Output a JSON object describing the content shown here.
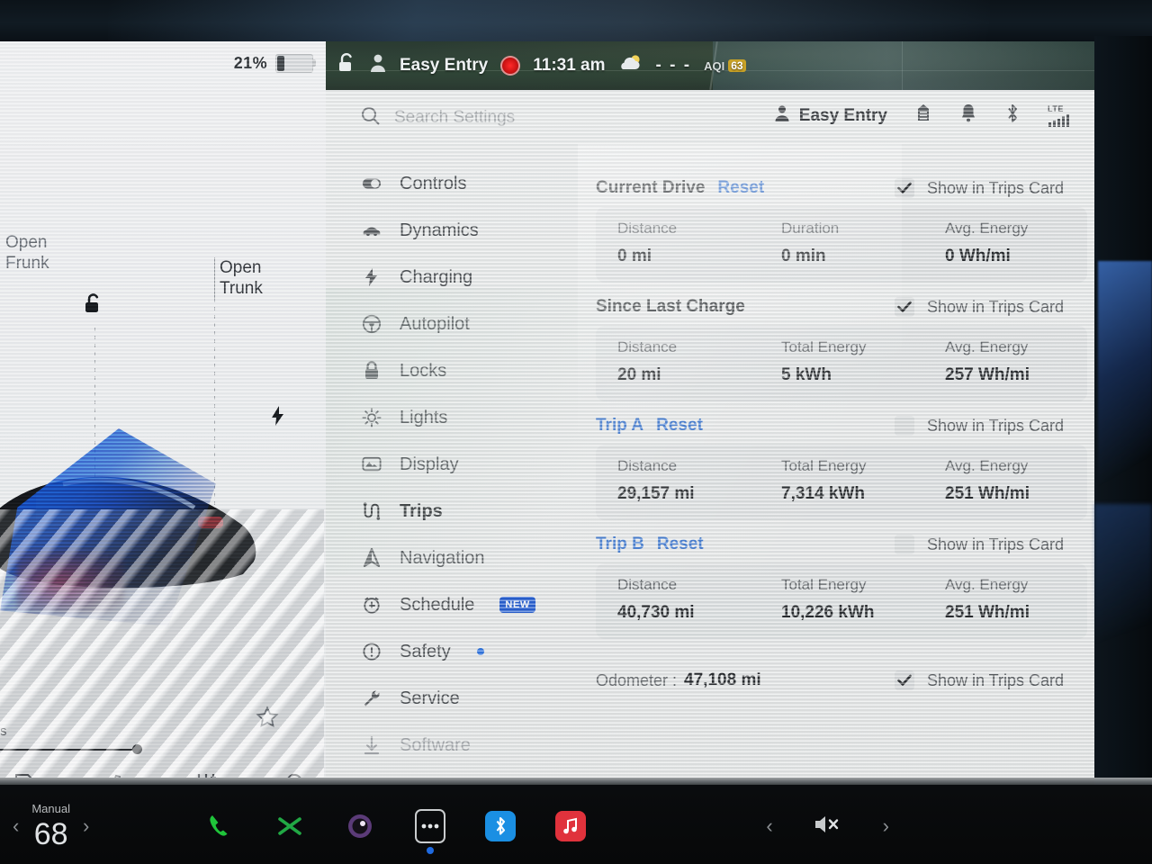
{
  "status_bar": {
    "lock_icon": "unlock-icon",
    "profile_icon": "person-icon",
    "profile_name": "Easy Entry",
    "record_icon": "record-dot-icon",
    "time": "11:31 am",
    "weather_icon": "partly-cloudy-icon",
    "temperature": "- - -",
    "aqi_label": "AQI",
    "aqi_value": "63"
  },
  "left_panel": {
    "battery_percent": "21%",
    "battery_level": 21,
    "frunk_label": "Open\nFrunk",
    "frunk_label_line1": "Open",
    "frunk_label_line2": "Frunk",
    "trunk_label_line1": "Open",
    "trunk_label_line2": "Trunk",
    "unlock_icon": "unlock-icon",
    "charge_icon": "bolt-icon",
    "media": {
      "favorite_icon": "star-icon",
      "song_fragment": "s",
      "thumbs_down_icon": "thumbs-down-icon",
      "thumbs_up_icon": "thumbs-up-icon",
      "equalizer_icon": "sliders-icon",
      "search_icon": "search-icon"
    }
  },
  "settings": {
    "search": {
      "icon": "search-icon",
      "placeholder": "Search Settings"
    },
    "header": {
      "profile_icon": "person-icon",
      "profile_name": "Easy Entry",
      "key_icon": "key-card-icon",
      "bell_icon": "bell-icon",
      "bluetooth_icon": "bluetooth-icon",
      "network_label": "LTE",
      "signal_icon": "signal-bars-icon"
    },
    "nav": [
      {
        "label": "Controls",
        "icon": "toggle-icon",
        "state": "normal"
      },
      {
        "label": "Dynamics",
        "icon": "car-icon",
        "state": "normal"
      },
      {
        "label": "Charging",
        "icon": "bolt-icon",
        "state": "normal"
      },
      {
        "label": "Autopilot",
        "icon": "steering-wheel-icon",
        "state": "normal"
      },
      {
        "label": "Locks",
        "icon": "padlock-icon",
        "state": "normal"
      },
      {
        "label": "Lights",
        "icon": "light-icon",
        "state": "normal"
      },
      {
        "label": "Display",
        "icon": "display-icon",
        "state": "normal"
      },
      {
        "label": "Trips",
        "icon": "trips-icon",
        "state": "selected"
      },
      {
        "label": "Navigation",
        "icon": "navigation-arrow-icon",
        "state": "normal"
      },
      {
        "label": "Schedule",
        "icon": "schedule-clock-icon",
        "state": "normal",
        "badge": "NEW"
      },
      {
        "label": "Safety",
        "icon": "alert-circle-icon",
        "state": "normal",
        "dot": true
      },
      {
        "label": "Service",
        "icon": "wrench-icon",
        "state": "normal"
      },
      {
        "label": "Software",
        "icon": "download-icon",
        "state": "dim"
      }
    ],
    "show_in_trips_card_label": "Show in Trips Card",
    "reset_label": "Reset",
    "sections": [
      {
        "title": "Current Drive",
        "has_reset": true,
        "title_is_link": false,
        "checked": true,
        "stats": [
          {
            "label": "Distance",
            "value": "0 mi"
          },
          {
            "label": "Duration",
            "value": "0 min"
          },
          {
            "label": "Avg. Energy",
            "value": "0 Wh/mi"
          }
        ]
      },
      {
        "title": "Since Last Charge",
        "has_reset": false,
        "title_is_link": false,
        "checked": true,
        "stats": [
          {
            "label": "Distance",
            "value": "20 mi"
          },
          {
            "label": "Total Energy",
            "value": "5 kWh"
          },
          {
            "label": "Avg. Energy",
            "value": "257 Wh/mi"
          }
        ]
      },
      {
        "title": "Trip A",
        "has_reset": true,
        "title_is_link": true,
        "checked": false,
        "stats": [
          {
            "label": "Distance",
            "value": "29,157 mi"
          },
          {
            "label": "Total Energy",
            "value": "7,314 kWh"
          },
          {
            "label": "Avg. Energy",
            "value": "251 Wh/mi"
          }
        ]
      },
      {
        "title": "Trip B",
        "has_reset": true,
        "title_is_link": true,
        "checked": false,
        "stats": [
          {
            "label": "Distance",
            "value": "40,730 mi"
          },
          {
            "label": "Total Energy",
            "value": "10,226 kWh"
          },
          {
            "label": "Avg. Energy",
            "value": "251 Wh/mi"
          }
        ]
      }
    ],
    "odometer": {
      "label": "Odometer :",
      "value": "47,108 mi",
      "checked": true
    }
  },
  "dock": {
    "temp_mode": "Manual",
    "temp_value": "68",
    "prev_icon": "chevron-left-icon",
    "next_icon": "chevron-right-icon",
    "apps": [
      {
        "name": "phone-icon",
        "color": "#1fc43a"
      },
      {
        "name": "xfinity-icon",
        "color": "#21a844"
      },
      {
        "name": "camera-icon",
        "color": "#7b4fa0"
      },
      {
        "name": "more-icon",
        "color": "#d8dadc",
        "active": true
      },
      {
        "name": "bluetooth-app-icon",
        "color": "#1a8fe3"
      },
      {
        "name": "music-icon",
        "color": "#e0323c"
      }
    ],
    "volume": {
      "prev_icon": "chevron-left-icon",
      "mute_icon": "volume-mute-icon",
      "next_icon": "chevron-right-icon"
    }
  },
  "colors": {
    "accent_blue": "#2f6fd0",
    "badge_blue": "#1552cf",
    "panel_bg": "#e8eaea",
    "text_dark": "#15181b"
  }
}
